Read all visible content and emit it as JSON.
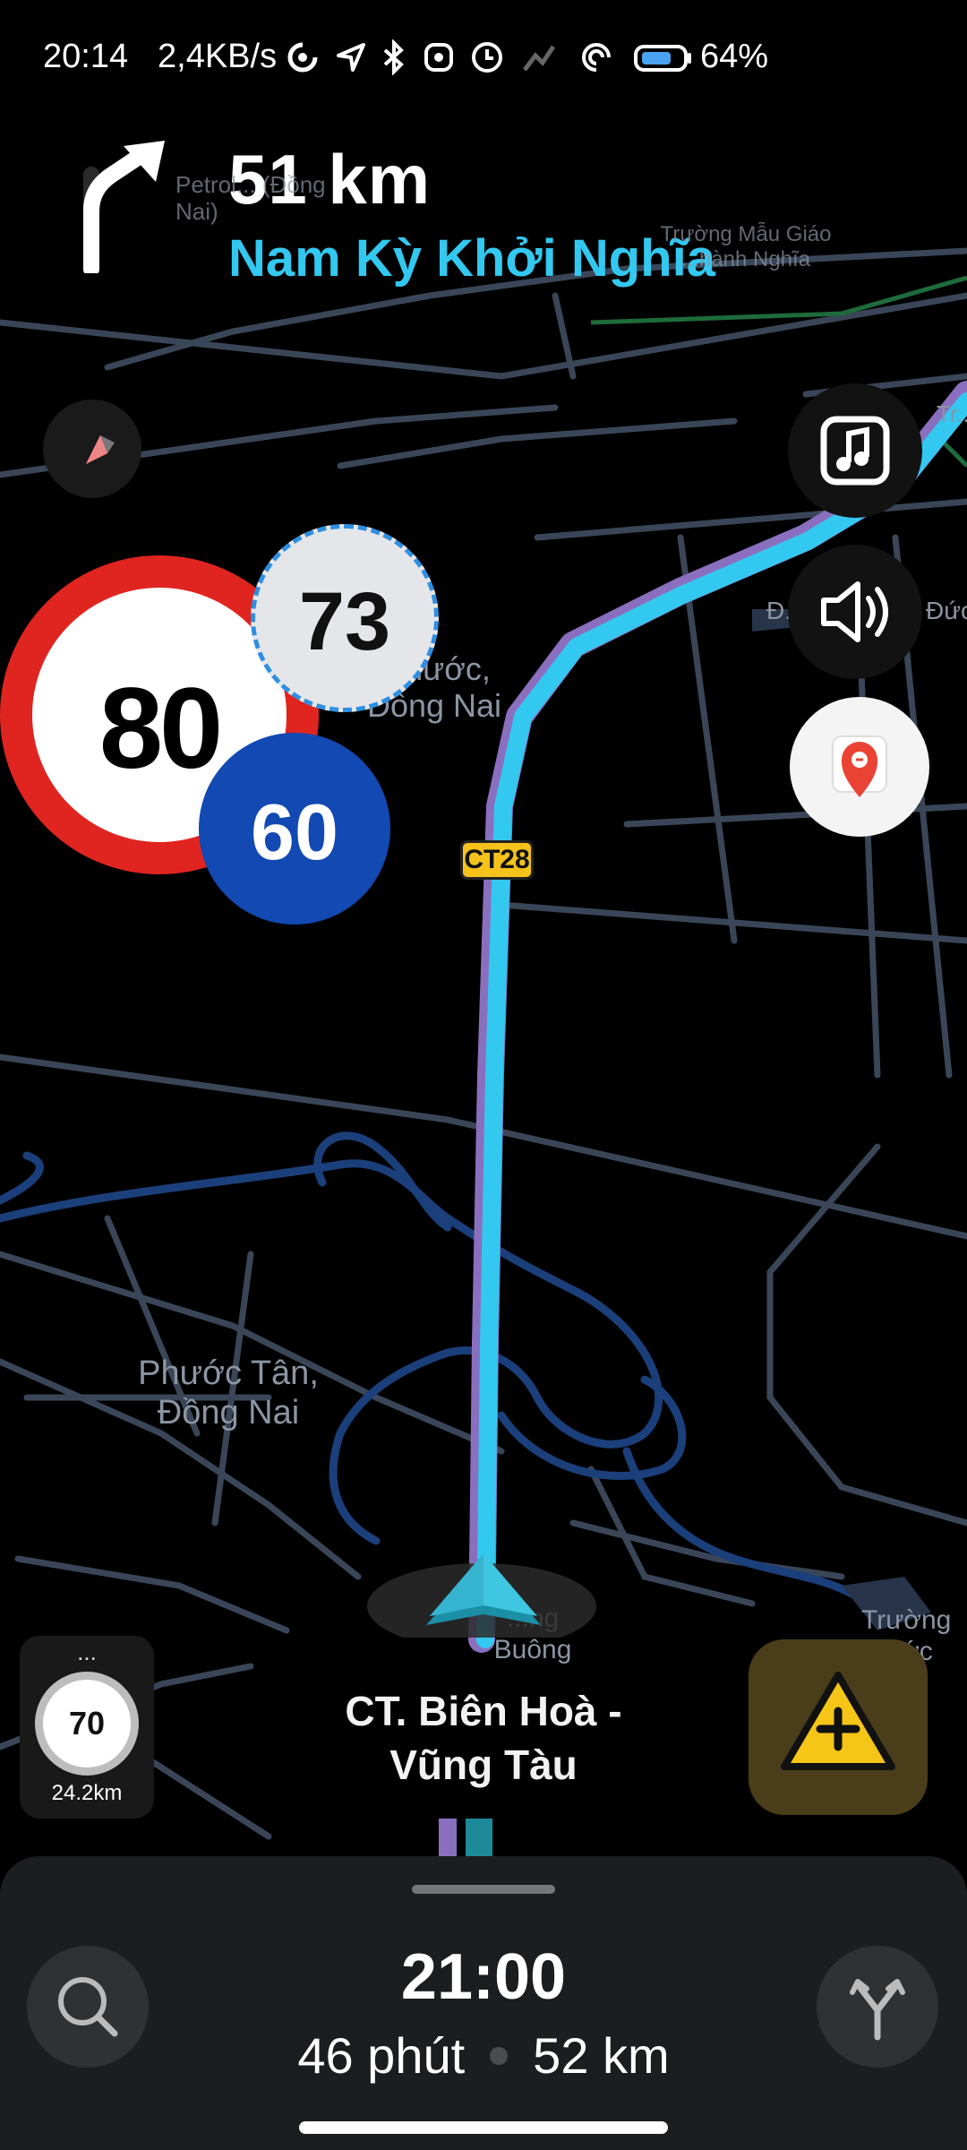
{
  "status_bar": {
    "time": "20:14",
    "network_speed": "2,4KB/s",
    "battery": "64%",
    "icons": [
      "sync-icon",
      "navigation-icon",
      "bluetooth-icon",
      "app-icon",
      "clock-icon",
      "signal-icon",
      "hotspot-icon",
      "battery-icon"
    ]
  },
  "navigation": {
    "turn_direction": "turn-right",
    "distance": "51 km",
    "next_street": "Nam Kỳ Khởi Nghĩa"
  },
  "map_labels": {
    "petrol": "Petrol... (Đồng Nai)",
    "school": "Trường Mẫu Giáo ...hành Nghĩa",
    "phuoc": "...hước, Đồng Nai",
    "phuoc_tan": "Phước Tân, Đồng Nai",
    "truong_right": "Trường ...ước",
    "cong_buong": "...ng Buông",
    "edge_tr": "Tr...",
    "edge_d": "Đ...",
    "edge_duc": "Đức"
  },
  "speed": {
    "limit": "80",
    "current": "73",
    "cruise": "60"
  },
  "road_shield": "CT28",
  "current_road": "CT. Biên Hoà - Vũng Tàu",
  "mini_speedometer": {
    "menu": "...",
    "speed": "70",
    "distance": "24.2km"
  },
  "bottom_panel": {
    "arrival_time": "21:00",
    "duration": "46 phút",
    "distance": "52 km"
  },
  "colors": {
    "route": "#33c8f0",
    "speed_limit_border": "#e02420",
    "cruise": "#1249b2",
    "report": "#f5c518",
    "road": "#3e4a5c",
    "water": "#1b3f7a"
  }
}
